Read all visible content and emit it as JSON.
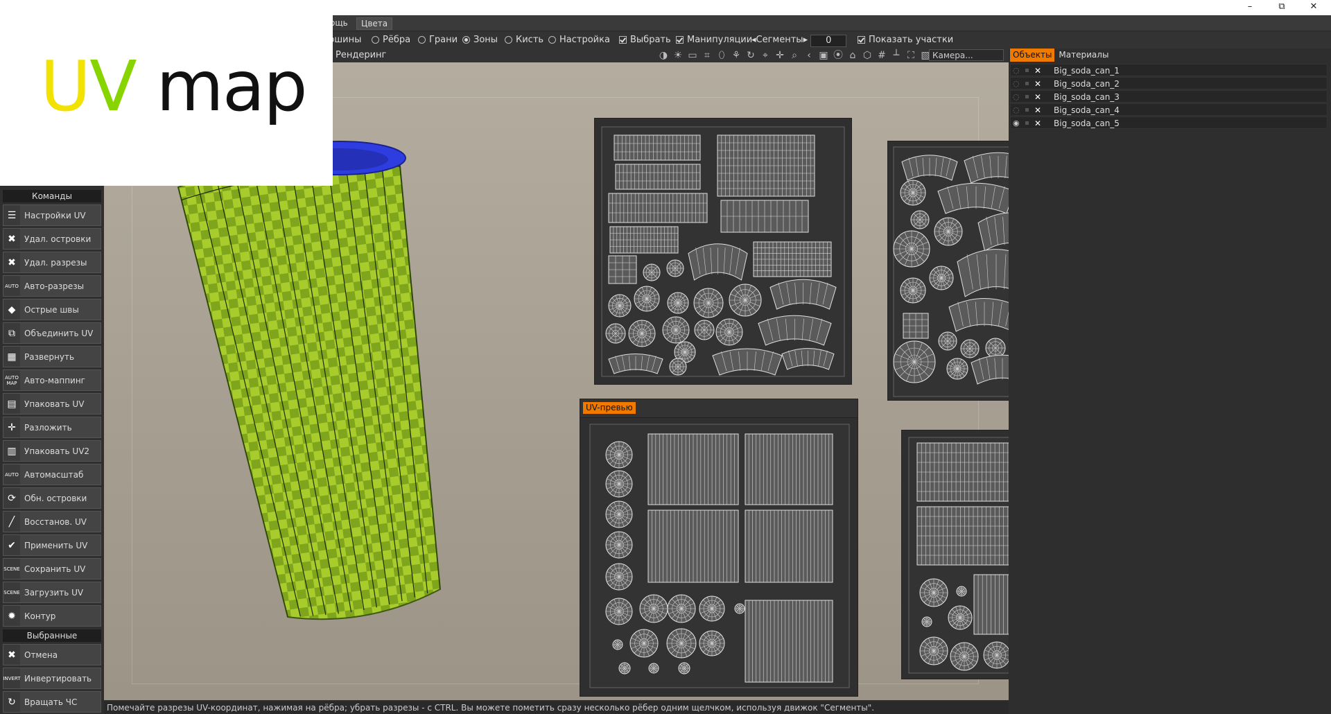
{
  "window": {
    "minimize": "–",
    "restore": "⧉",
    "close": "✕"
  },
  "menubar": {
    "items": [
      "ощь",
      "Цвета"
    ]
  },
  "toolbar": {
    "modes": [
      {
        "label": "ершины",
        "selected": false
      },
      {
        "label": "Рёбра",
        "selected": false
      },
      {
        "label": "Грани",
        "selected": false
      },
      {
        "label": "Зоны",
        "selected": true
      },
      {
        "label": "Кисть",
        "selected": false
      },
      {
        "label": "Настройка",
        "selected": false
      }
    ],
    "select_label": "Выбрать",
    "manip_label": "Манипуляции",
    "segments_label": "◂Сегменты▸",
    "segments_value": "0",
    "show_label": "Показать  участки",
    "render_label": "Рендеринг",
    "camera_value": "Камера...",
    "icons": [
      "◑",
      "☀",
      "▭",
      "⌗",
      "⬯",
      "⚘",
      "↻",
      "⌖",
      "✛",
      "⌕",
      "‹",
      "▣",
      "⦿",
      "⌂",
      "⬡",
      "#",
      "┴",
      "⛶",
      "▧"
    ]
  },
  "objects_panel": {
    "tabs": [
      "Объекты",
      "Материалы"
    ],
    "objects": [
      "Big_soda_can_1",
      "Big_soda_can_2",
      "Big_soda_can_3",
      "Big_soda_can_4",
      "Big_soda_can_5"
    ]
  },
  "commands": {
    "header": "Команды",
    "items": [
      {
        "label": "Настройки UV",
        "icon": "sliders-icon",
        "glyph": "☰"
      },
      {
        "label": "Удал. островки",
        "icon": "delete-islands-icon",
        "glyph": "✖"
      },
      {
        "label": "Удал. разрезы",
        "icon": "delete-seams-icon",
        "glyph": "✖"
      },
      {
        "label": "Авто-разрезы",
        "icon": "auto-seams-icon",
        "glyph": "AUTO"
      },
      {
        "label": "Острые швы",
        "icon": "sharp-seams-icon",
        "glyph": "◆"
      },
      {
        "label": "Объединить UV",
        "icon": "merge-uv-icon",
        "glyph": "⧉"
      },
      {
        "label": "Развернуть",
        "icon": "unwrap-icon",
        "glyph": "▦"
      },
      {
        "label": "Авто-маппинг",
        "icon": "auto-map-icon",
        "glyph": "AUTO MAP"
      },
      {
        "label": "Упаковать UV",
        "icon": "pack-uv-icon",
        "glyph": "▤"
      },
      {
        "label": "Разложить",
        "icon": "spread-icon",
        "glyph": "✛"
      },
      {
        "label": "Упаковать UV2",
        "icon": "pack-uv2-icon",
        "glyph": "▥"
      },
      {
        "label": "Автомасштаб",
        "icon": "auto-scale-icon",
        "glyph": "AUTO"
      },
      {
        "label": "Обн. островки",
        "icon": "refresh-islands-icon",
        "glyph": "⟳"
      },
      {
        "label": "Восстанов. UV",
        "icon": "restore-uv-icon",
        "glyph": "╱"
      },
      {
        "label": "Применить UV",
        "icon": "apply-uv-icon",
        "glyph": "✔"
      },
      {
        "label": "Сохранить UV",
        "icon": "save-uv-icon",
        "glyph": "SCENE"
      },
      {
        "label": "Загрузить UV",
        "icon": "load-uv-icon",
        "glyph": "SCENE"
      },
      {
        "label": "Контур",
        "icon": "contour-icon",
        "glyph": "✹"
      }
    ],
    "selected_header": "Выбранные",
    "selected_items": [
      {
        "label": "Отмена",
        "icon": "cancel-icon",
        "glyph": "✖"
      },
      {
        "label": "Инвертировать",
        "icon": "invert-icon",
        "glyph": "INVERT"
      },
      {
        "label": "Вращать ЧС",
        "icon": "rotate-cw-icon",
        "glyph": "↻"
      }
    ]
  },
  "uv_preview": {
    "title": "UV-превью"
  },
  "status": {
    "text": "Помечайте разрезы UV-координат, нажимая на рёбра; убрать разрезы - с CTRL. Вы можете пометить сразу несколько рёбер одним щелчком, используя движок \"Сегменты\"."
  },
  "overlay": {
    "u": "U",
    "v": "V",
    "rest": " map"
  },
  "colors": {
    "accent": "#f07a00",
    "checker_light": "#a8cc2c",
    "checker_dark": "#7ea51c",
    "cap_blue": "#2e3de0"
  }
}
